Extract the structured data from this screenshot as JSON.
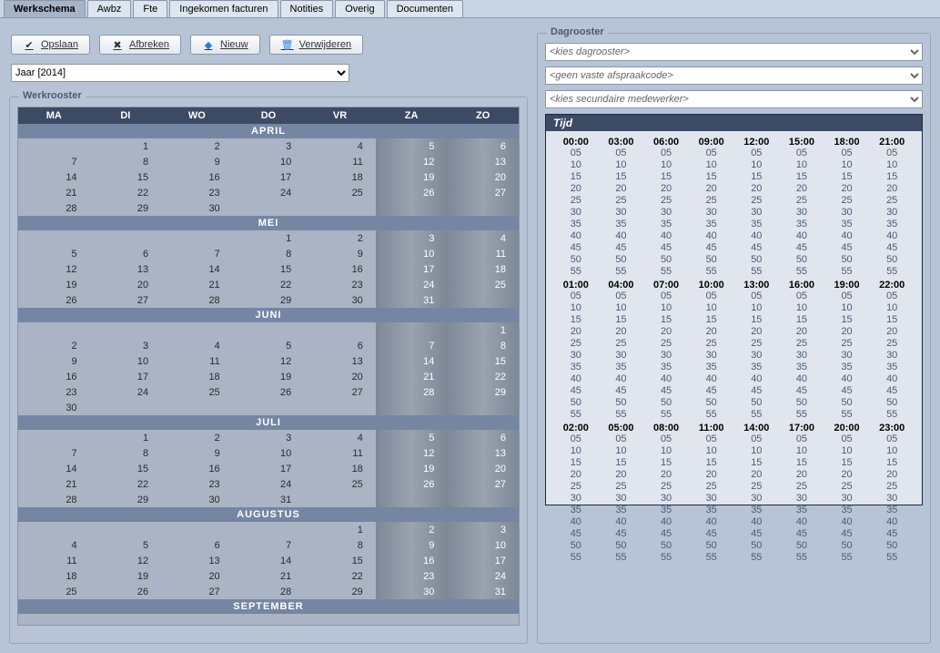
{
  "tabs": [
    {
      "label": "Werkschema",
      "active": true
    },
    {
      "label": "Awbz"
    },
    {
      "label": "Fte"
    },
    {
      "label": "Ingekomen facturen"
    },
    {
      "label": "Notities"
    },
    {
      "label": "Overig"
    },
    {
      "label": "Documenten"
    }
  ],
  "toolbar": {
    "save_label": "Opslaan",
    "cancel_label": "Afbreken",
    "new_label": "Nieuw",
    "delete_label": "Verwijderen"
  },
  "year_select": "Jaar [2014]",
  "werkrooster_legend": "Werkrooster",
  "dagrooster_legend": "Dagrooster",
  "day_headers": [
    "MA",
    "DI",
    "WO",
    "DO",
    "VR",
    "ZA",
    "ZO"
  ],
  "weekend_cols": [
    5,
    6
  ],
  "months": [
    {
      "name": "APRIL",
      "weeks": [
        [
          "",
          "1",
          "2",
          "3",
          "4",
          "5",
          "6"
        ],
        [
          "7",
          "8",
          "9",
          "10",
          "11",
          "12",
          "13"
        ],
        [
          "14",
          "15",
          "16",
          "17",
          "18",
          "19",
          "20"
        ],
        [
          "21",
          "22",
          "23",
          "24",
          "25",
          "26",
          "27"
        ],
        [
          "28",
          "29",
          "30",
          "",
          "",
          "",
          ""
        ]
      ]
    },
    {
      "name": "MEI",
      "weeks": [
        [
          "",
          "",
          "",
          "1",
          "2",
          "3",
          "4"
        ],
        [
          "5",
          "6",
          "7",
          "8",
          "9",
          "10",
          "11"
        ],
        [
          "12",
          "13",
          "14",
          "15",
          "16",
          "17",
          "18"
        ],
        [
          "19",
          "20",
          "21",
          "22",
          "23",
          "24",
          "25"
        ],
        [
          "26",
          "27",
          "28",
          "29",
          "30",
          "31",
          ""
        ]
      ]
    },
    {
      "name": "JUNI",
      "weeks": [
        [
          "",
          "",
          "",
          "",
          "",
          "",
          "1"
        ],
        [
          "2",
          "3",
          "4",
          "5",
          "6",
          "7",
          "8"
        ],
        [
          "9",
          "10",
          "11",
          "12",
          "13",
          "14",
          "15"
        ],
        [
          "16",
          "17",
          "18",
          "19",
          "20",
          "21",
          "22"
        ],
        [
          "23",
          "24",
          "25",
          "26",
          "27",
          "28",
          "29"
        ],
        [
          "30",
          "",
          "",
          "",
          "",
          "",
          ""
        ]
      ]
    },
    {
      "name": "JULI",
      "weeks": [
        [
          "",
          "1",
          "2",
          "3",
          "4",
          "5",
          "6"
        ],
        [
          "7",
          "8",
          "9",
          "10",
          "11",
          "12",
          "13"
        ],
        [
          "14",
          "15",
          "16",
          "17",
          "18",
          "19",
          "20"
        ],
        [
          "21",
          "22",
          "23",
          "24",
          "25",
          "26",
          "27"
        ],
        [
          "28",
          "29",
          "30",
          "31",
          "",
          "",
          ""
        ]
      ]
    },
    {
      "name": "AUGUSTUS",
      "weeks": [
        [
          "",
          "",
          "",
          "",
          "1",
          "2",
          "3"
        ],
        [
          "4",
          "5",
          "6",
          "7",
          "8",
          "9",
          "10"
        ],
        [
          "11",
          "12",
          "13",
          "14",
          "15",
          "16",
          "17"
        ],
        [
          "18",
          "19",
          "20",
          "21",
          "22",
          "23",
          "24"
        ],
        [
          "25",
          "26",
          "27",
          "28",
          "29",
          "30",
          "31"
        ]
      ]
    },
    {
      "name": "SEPTEMBER",
      "weeks": []
    }
  ],
  "dag_selects": [
    "<kies dagrooster>",
    "<geen vaste afspraakcode>",
    "<kies secundaire medewerker>"
  ],
  "tijd_header": "Tijd",
  "tijd_groups": [
    [
      "00:00",
      "03:00",
      "06:00",
      "09:00",
      "12:00",
      "15:00",
      "18:00",
      "21:00"
    ],
    [
      "01:00",
      "04:00",
      "07:00",
      "10:00",
      "13:00",
      "16:00",
      "19:00",
      "22:00"
    ],
    [
      "02:00",
      "05:00",
      "08:00",
      "11:00",
      "14:00",
      "17:00",
      "20:00",
      "23:00"
    ]
  ],
  "tijd_minutes": [
    "05",
    "10",
    "15",
    "20",
    "25",
    "30",
    "35",
    "40",
    "45",
    "50",
    "55"
  ]
}
